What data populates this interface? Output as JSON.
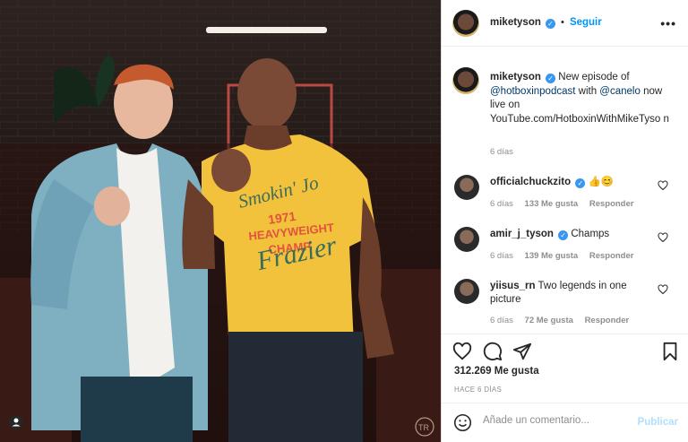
{
  "post": {
    "username": "miketyson",
    "follow_label": "Seguir",
    "more_label": "•••",
    "dot": "•",
    "caption": {
      "prefix": "New episode of",
      "mention1": "@hotboxinpodcast",
      "middle": "with",
      "mention2": "@canelo",
      "suffix": "now live on YouTube.com/HotboxinWithMikeTyso n",
      "time": "6 días"
    },
    "photo": {
      "shirt_text_1": "Smokin' Jo",
      "shirt_text_2": "1971",
      "shirt_text_3": "HEAVYWEIGHT",
      "shirt_text_4": "CHAMP",
      "shirt_text_5": "Frazier",
      "watermark": "TR"
    }
  },
  "comments": [
    {
      "username": "officialchuckzito",
      "text": "👍😊",
      "time": "6 días",
      "likes": "133 Me gusta",
      "reply": "Responder",
      "verified": true
    },
    {
      "username": "amir_j_tyson",
      "text": "Champs",
      "time": "6 días",
      "likes": "139 Me gusta",
      "reply": "Responder",
      "verified": true
    },
    {
      "username": "yiisus_rn",
      "text": "Two legends in one picture",
      "time": "6 días",
      "likes": "72 Me gusta",
      "reply": "Responder",
      "verified": false
    }
  ],
  "likes_label": "312.269 Me gusta",
  "time_ago": "HACE 6 DÍAS",
  "add_comment": {
    "placeholder": "Añade un comentario...",
    "publish_label": "Publicar"
  },
  "colors": {
    "accent": "#0095f6",
    "link": "#00376b",
    "verified": "#3897f0",
    "shirt": "#f2c23c"
  }
}
